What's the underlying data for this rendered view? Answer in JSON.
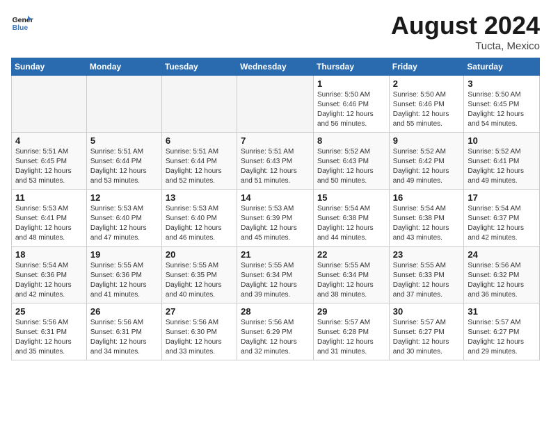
{
  "header": {
    "logo_line1": "General",
    "logo_line2": "Blue",
    "month_year": "August 2024",
    "location": "Tucta, Mexico"
  },
  "days_of_week": [
    "Sunday",
    "Monday",
    "Tuesday",
    "Wednesday",
    "Thursday",
    "Friday",
    "Saturday"
  ],
  "weeks": [
    [
      {
        "day": "",
        "empty": true
      },
      {
        "day": "",
        "empty": true
      },
      {
        "day": "",
        "empty": true
      },
      {
        "day": "",
        "empty": true
      },
      {
        "day": "1",
        "sunrise": "5:50 AM",
        "sunset": "6:46 PM",
        "daylight": "12 hours and 56 minutes."
      },
      {
        "day": "2",
        "sunrise": "5:50 AM",
        "sunset": "6:46 PM",
        "daylight": "12 hours and 55 minutes."
      },
      {
        "day": "3",
        "sunrise": "5:50 AM",
        "sunset": "6:45 PM",
        "daylight": "12 hours and 54 minutes."
      }
    ],
    [
      {
        "day": "4",
        "sunrise": "5:51 AM",
        "sunset": "6:45 PM",
        "daylight": "12 hours and 53 minutes."
      },
      {
        "day": "5",
        "sunrise": "5:51 AM",
        "sunset": "6:44 PM",
        "daylight": "12 hours and 53 minutes."
      },
      {
        "day": "6",
        "sunrise": "5:51 AM",
        "sunset": "6:44 PM",
        "daylight": "12 hours and 52 minutes."
      },
      {
        "day": "7",
        "sunrise": "5:51 AM",
        "sunset": "6:43 PM",
        "daylight": "12 hours and 51 minutes."
      },
      {
        "day": "8",
        "sunrise": "5:52 AM",
        "sunset": "6:43 PM",
        "daylight": "12 hours and 50 minutes."
      },
      {
        "day": "9",
        "sunrise": "5:52 AM",
        "sunset": "6:42 PM",
        "daylight": "12 hours and 49 minutes."
      },
      {
        "day": "10",
        "sunrise": "5:52 AM",
        "sunset": "6:41 PM",
        "daylight": "12 hours and 49 minutes."
      }
    ],
    [
      {
        "day": "11",
        "sunrise": "5:53 AM",
        "sunset": "6:41 PM",
        "daylight": "12 hours and 48 minutes."
      },
      {
        "day": "12",
        "sunrise": "5:53 AM",
        "sunset": "6:40 PM",
        "daylight": "12 hours and 47 minutes."
      },
      {
        "day": "13",
        "sunrise": "5:53 AM",
        "sunset": "6:40 PM",
        "daylight": "12 hours and 46 minutes."
      },
      {
        "day": "14",
        "sunrise": "5:53 AM",
        "sunset": "6:39 PM",
        "daylight": "12 hours and 45 minutes."
      },
      {
        "day": "15",
        "sunrise": "5:54 AM",
        "sunset": "6:38 PM",
        "daylight": "12 hours and 44 minutes."
      },
      {
        "day": "16",
        "sunrise": "5:54 AM",
        "sunset": "6:38 PM",
        "daylight": "12 hours and 43 minutes."
      },
      {
        "day": "17",
        "sunrise": "5:54 AM",
        "sunset": "6:37 PM",
        "daylight": "12 hours and 42 minutes."
      }
    ],
    [
      {
        "day": "18",
        "sunrise": "5:54 AM",
        "sunset": "6:36 PM",
        "daylight": "12 hours and 42 minutes."
      },
      {
        "day": "19",
        "sunrise": "5:55 AM",
        "sunset": "6:36 PM",
        "daylight": "12 hours and 41 minutes."
      },
      {
        "day": "20",
        "sunrise": "5:55 AM",
        "sunset": "6:35 PM",
        "daylight": "12 hours and 40 minutes."
      },
      {
        "day": "21",
        "sunrise": "5:55 AM",
        "sunset": "6:34 PM",
        "daylight": "12 hours and 39 minutes."
      },
      {
        "day": "22",
        "sunrise": "5:55 AM",
        "sunset": "6:34 PM",
        "daylight": "12 hours and 38 minutes."
      },
      {
        "day": "23",
        "sunrise": "5:55 AM",
        "sunset": "6:33 PM",
        "daylight": "12 hours and 37 minutes."
      },
      {
        "day": "24",
        "sunrise": "5:56 AM",
        "sunset": "6:32 PM",
        "daylight": "12 hours and 36 minutes."
      }
    ],
    [
      {
        "day": "25",
        "sunrise": "5:56 AM",
        "sunset": "6:31 PM",
        "daylight": "12 hours and 35 minutes."
      },
      {
        "day": "26",
        "sunrise": "5:56 AM",
        "sunset": "6:31 PM",
        "daylight": "12 hours and 34 minutes."
      },
      {
        "day": "27",
        "sunrise": "5:56 AM",
        "sunset": "6:30 PM",
        "daylight": "12 hours and 33 minutes."
      },
      {
        "day": "28",
        "sunrise": "5:56 AM",
        "sunset": "6:29 PM",
        "daylight": "12 hours and 32 minutes."
      },
      {
        "day": "29",
        "sunrise": "5:57 AM",
        "sunset": "6:28 PM",
        "daylight": "12 hours and 31 minutes."
      },
      {
        "day": "30",
        "sunrise": "5:57 AM",
        "sunset": "6:27 PM",
        "daylight": "12 hours and 30 minutes."
      },
      {
        "day": "31",
        "sunrise": "5:57 AM",
        "sunset": "6:27 PM",
        "daylight": "12 hours and 29 minutes."
      }
    ]
  ]
}
